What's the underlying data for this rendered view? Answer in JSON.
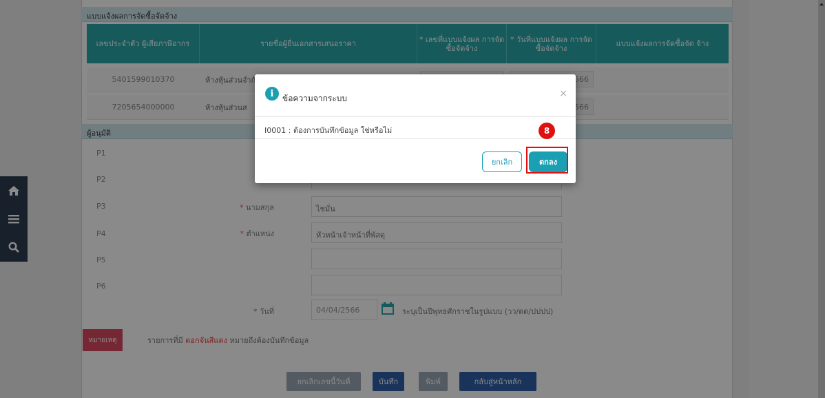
{
  "sections": {
    "report_title": "แบบแจ้งผลการจัดซื้อจัดจ้าง",
    "approver_title": "ผู้อนุมัติ"
  },
  "grid": {
    "headers": [
      "เลขประจำตัว ผู้เสียภาษีอากร",
      "รายชื่อผู้ยื่นเอกสารเสนอราคา",
      "* เลขที่แบบแจ้งผล การจัดซื้อจัดจ้าง",
      "* วันที่แบบแจ้งผล การจัดซื้อจัดจ้าง",
      "แบบแจ้งผลการจัดซื้อจัด จ้าง"
    ],
    "rows": [
      {
        "tax_id": "5401599010370",
        "name": "ห้างหุ้นส่วนจำกัดก้าวไปทรงทรัพย์",
        "date": "566"
      },
      {
        "tax_id": "7205654000000",
        "name": "ห้างหุ้นส่วนส",
        "date": "566"
      }
    ]
  },
  "approvers": {
    "labels": [
      "P1",
      "P2",
      "P3",
      "P4",
      "P5",
      "P6"
    ],
    "lastname_label": "นามสกุล",
    "lastname_value": "ไชมั่น",
    "position_label": "ตำแหน่ง",
    "position_value": "หัวหน้าเจ้าหน้าที่พัสดุ",
    "date_label": "วันที่",
    "date_value": "04/04/2566",
    "date_hint": "ระบุเป็นปีพุทธศักราชในรูปแบบ (วว/ดด/ปปปป)"
  },
  "note": {
    "badge": "หมายเหตุ",
    "text_prefix": "รายการที่มี",
    "text_red": "ดอกจันสีแดง",
    "text_suffix": "หมายถึงต้องบันทึกข้อมูล"
  },
  "footer_buttons": {
    "cancel_edit": "ยกเลิกเลขนี้วันที่",
    "save": "บันทึก",
    "print": "พิมพ์",
    "home": "กลับสู่หน้าหลัก"
  },
  "modal": {
    "title": "ข้อความจากระบบ",
    "message": "I0001 : ต้องการบันทึกข้อมูล ใช่หรือไม่",
    "cancel": "ยกเลิก",
    "ok": "ตกลง",
    "close": "×"
  },
  "annotation": {
    "step": "8"
  },
  "colors": {
    "teal": "#2aa7a8",
    "modal_teal": "#1a9fb3",
    "highlight": "#e01010",
    "nav_dark": "#2d3e50"
  }
}
